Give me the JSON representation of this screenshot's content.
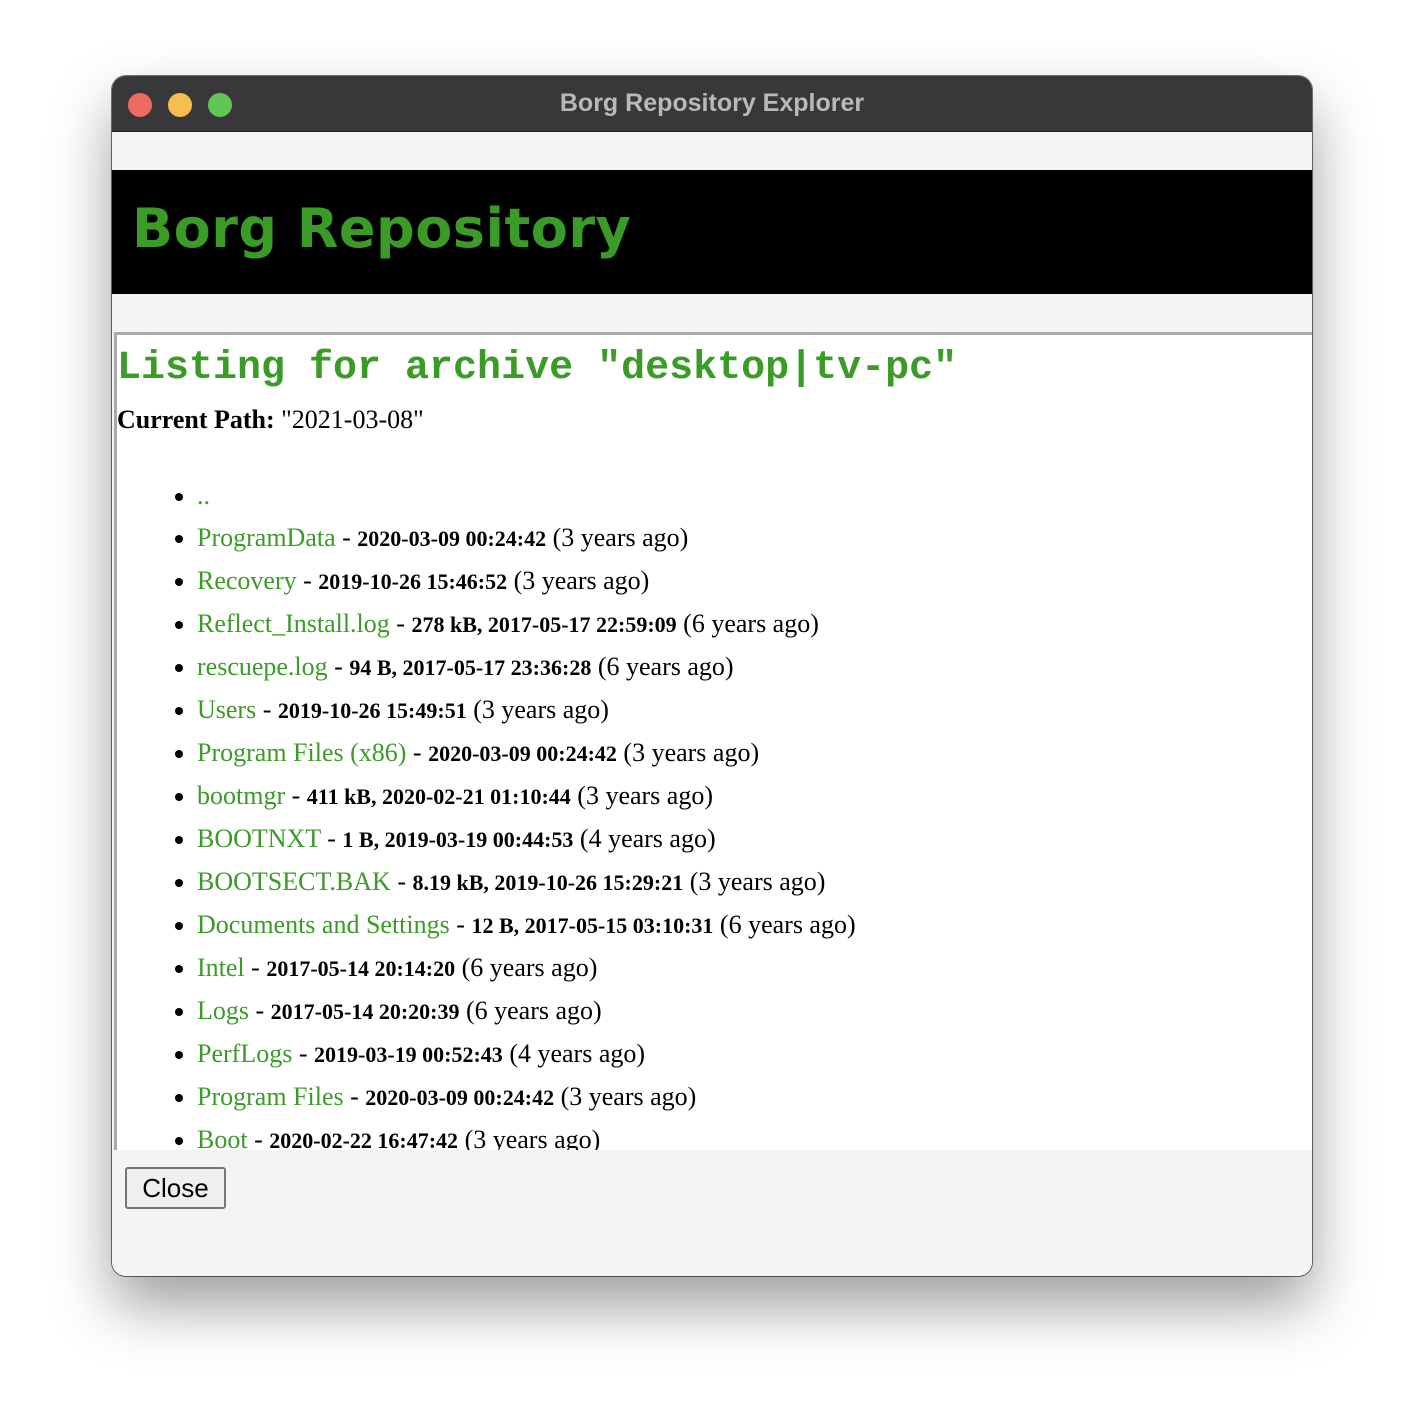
{
  "window": {
    "title": "Borg Repository Explorer"
  },
  "banner": {
    "title": "Borg Repository"
  },
  "main": {
    "heading": "Listing for archive \"desktop|tv-pc\"",
    "current_path_label": "Current Path:",
    "current_path_value": "\"2021-03-08\"",
    "entries": [
      {
        "name": "..",
        "sep": "",
        "meta": "",
        "ago": ""
      },
      {
        "name": "ProgramData",
        "sep": " - ",
        "meta": "2020-03-09 00:24:42",
        "ago": " (3 years ago)"
      },
      {
        "name": "Recovery",
        "sep": " - ",
        "meta": "2019-10-26 15:46:52",
        "ago": " (3 years ago)"
      },
      {
        "name": "Reflect_Install.log",
        "sep": " - ",
        "meta": "278 kB, 2017-05-17 22:59:09",
        "ago": " (6 years ago)"
      },
      {
        "name": "rescuepe.log",
        "sep": " - ",
        "meta": "94 B, 2017-05-17 23:36:28",
        "ago": " (6 years ago)"
      },
      {
        "name": "Users",
        "sep": " - ",
        "meta": "2019-10-26 15:49:51",
        "ago": " (3 years ago)"
      },
      {
        "name": "Program Files (x86)",
        "sep": " - ",
        "meta": "2020-03-09 00:24:42",
        "ago": " (3 years ago)"
      },
      {
        "name": "bootmgr",
        "sep": " - ",
        "meta": "411 kB, 2020-02-21 01:10:44",
        "ago": " (3 years ago)"
      },
      {
        "name": "BOOTNXT",
        "sep": " - ",
        "meta": "1 B, 2019-03-19 00:44:53",
        "ago": " (4 years ago)"
      },
      {
        "name": "BOOTSECT.BAK",
        "sep": " - ",
        "meta": "8.19 kB, 2019-10-26 15:29:21",
        "ago": " (3 years ago)"
      },
      {
        "name": "Documents and Settings",
        "sep": " - ",
        "meta": "12 B, 2017-05-15 03:10:31",
        "ago": " (6 years ago)"
      },
      {
        "name": "Intel",
        "sep": " - ",
        "meta": "2017-05-14 20:14:20",
        "ago": " (6 years ago)"
      },
      {
        "name": "Logs",
        "sep": " - ",
        "meta": "2017-05-14 20:20:39",
        "ago": " (6 years ago)"
      },
      {
        "name": "PerfLogs",
        "sep": " - ",
        "meta": "2019-03-19 00:52:43",
        "ago": " (4 years ago)"
      },
      {
        "name": "Program Files",
        "sep": " - ",
        "meta": "2020-03-09 00:24:42",
        "ago": " (3 years ago)"
      },
      {
        "name": "Boot",
        "sep": " - ",
        "meta": "2020-02-22 16:47:42",
        "ago": " (3 years ago)"
      }
    ]
  },
  "footer": {
    "close_label": "Close"
  },
  "colors": {
    "accent_green": "#3a9b26",
    "titlebar": "#38373a",
    "banner_bg": "#000000"
  }
}
